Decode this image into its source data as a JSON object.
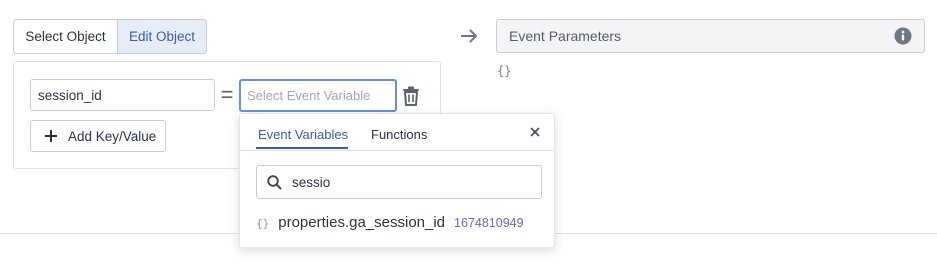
{
  "toggle": {
    "select_label": "Select Object",
    "edit_label": "Edit Object"
  },
  "mapping": {
    "key_value": "session_id",
    "equals": "=",
    "value_placeholder": "Select Event Variable",
    "add_label": "Add Key/Value"
  },
  "params": {
    "title": "Event Parameters",
    "preview": "{}"
  },
  "popup": {
    "tabs": [
      "Event Variables",
      "Functions"
    ],
    "active_tab": "Event Variables",
    "search_value": "sessio",
    "results": [
      {
        "icon": "{}",
        "name": "properties.ga_session_id",
        "value": "1674810949"
      }
    ]
  },
  "colors": {
    "accent": "#3b5aa8",
    "focus_border": "#6b8fd3",
    "value_text": "#6f64b8"
  },
  "icons": [
    "trash-icon",
    "plus-icon",
    "arrow-right-icon",
    "info-icon",
    "close-icon",
    "search-icon",
    "braces-icon"
  ]
}
